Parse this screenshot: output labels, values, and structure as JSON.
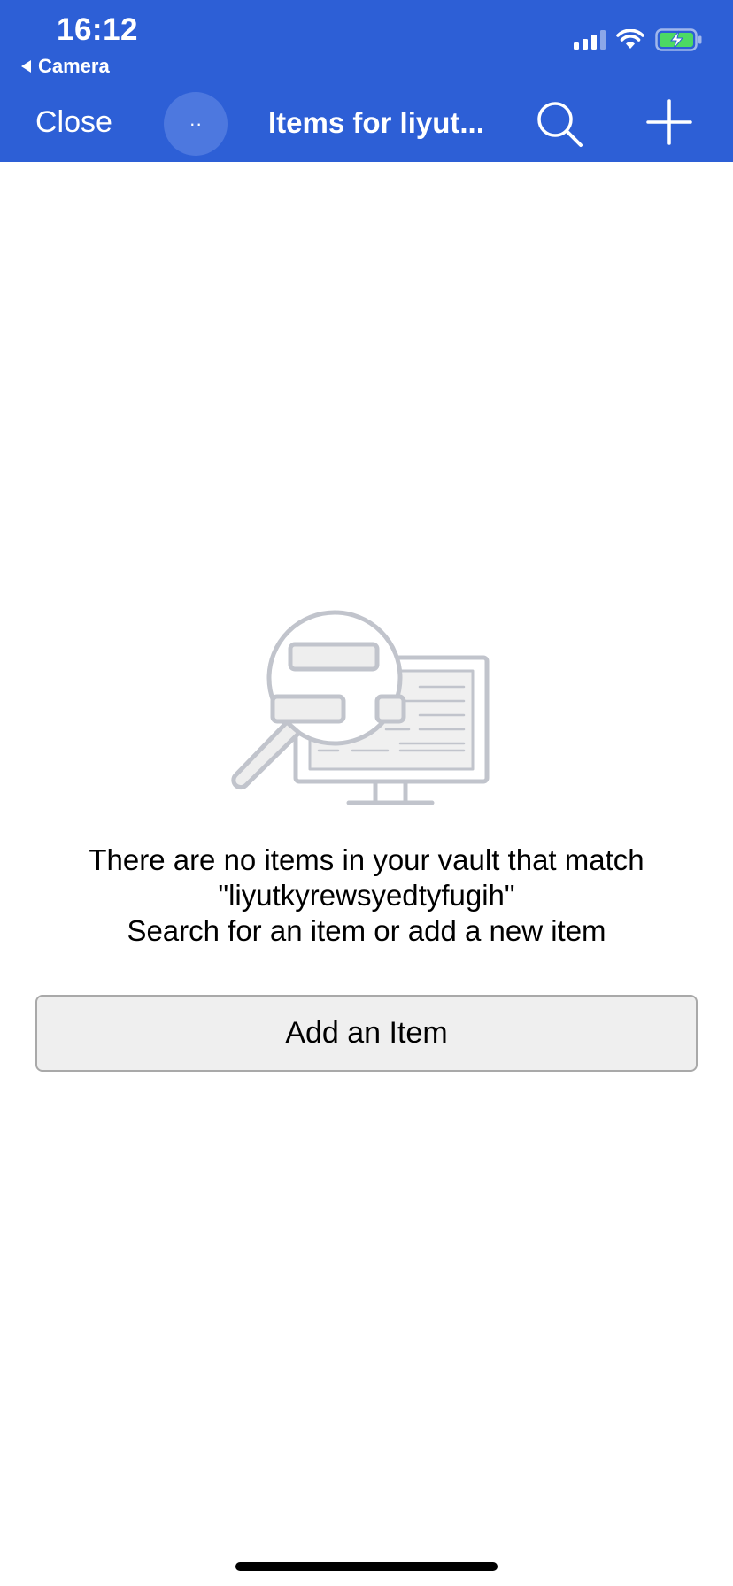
{
  "status_bar": {
    "time": "16:12",
    "back_label": "Camera",
    "icons": [
      "cellular-signal-icon",
      "wifi-icon",
      "battery-charging-icon"
    ]
  },
  "nav": {
    "close_label": "Close",
    "more_label": "··",
    "title": "Items for liyut...",
    "search_icon": "search-icon",
    "add_icon": "plus-icon"
  },
  "empty_state": {
    "illustration": "search-monitor-illustration",
    "line1": "There are no items in your vault that match",
    "line2": "\"liyutkyrewsyedtyfugih\"",
    "line3": "Search for an item or add a new item",
    "button_label": "Add an Item"
  },
  "colors": {
    "header_bg": "#2d5fd6",
    "button_bg": "#efefef",
    "illustration_stroke": "#c1c4cc"
  }
}
